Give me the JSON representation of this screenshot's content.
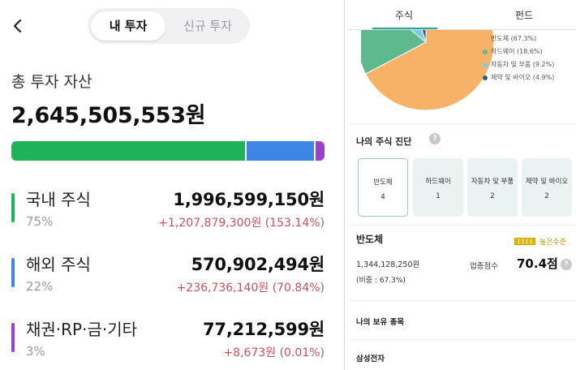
{
  "left": {
    "tabs": [
      "내 투자",
      "신규 투자"
    ],
    "total_label": "총 투자 자산",
    "total_value": "2,645,505,553원",
    "allocation": [
      {
        "fraction": 0.7547,
        "color": "#1fb25a"
      },
      {
        "fraction": 0.2158,
        "color": "#3d86e6"
      },
      {
        "fraction": 0.0292,
        "color": "#9b3fcf"
      }
    ],
    "assets": [
      {
        "name": "국내 주식",
        "pct": "75%",
        "amount": "1,996,599,150원",
        "gain": "+1,207,879,300원 (153.14%)",
        "color": "#1fb25a"
      },
      {
        "name": "해외 주식",
        "pct": "22%",
        "amount": "570,902,494원",
        "gain": "+236,736,140원 (70.84%)",
        "color": "#3d86e6"
      },
      {
        "name": "채권·RP·금·기타",
        "pct": "3%",
        "amount": "77,212,599원",
        "gain": "+8,673원 (0.01%)",
        "color": "#9b3fcf"
      }
    ]
  },
  "right": {
    "tabs": [
      "주식",
      "펀드"
    ],
    "legend": [
      {
        "label": "반도체 (67.3%)",
        "value": 67.3,
        "color": "#f7b267"
      },
      {
        "label": "하드웨어 (18.6%)",
        "value": 18.6,
        "color": "#5fb98f"
      },
      {
        "label": "자동차 및 부품 (9.2%)",
        "value": 9.2,
        "color": "#7ccbe6"
      },
      {
        "label": "제약 및 바이오 (4.9%)",
        "value": 4.9,
        "color": "#3b5a78"
      }
    ],
    "diagnosis_title": "나의 주식 진단",
    "help_icon": "?",
    "sector_cards": [
      {
        "name": "반도체",
        "count": "4"
      },
      {
        "name": "하드웨어",
        "count": "1"
      },
      {
        "name": "자동차 및 부품",
        "count": "2"
      },
      {
        "name": "제약 및 바이오",
        "count": "2"
      }
    ],
    "sector_detail": {
      "title": "반도체",
      "level_label": "높은수준",
      "amount": "1,344,128,250원",
      "weight": "(비중 : 67.3%)",
      "score_label": "업종점수",
      "score_value": "70.4점"
    },
    "holdings_title": "나의 보유 종목",
    "holding_first": "삼성전자"
  }
}
